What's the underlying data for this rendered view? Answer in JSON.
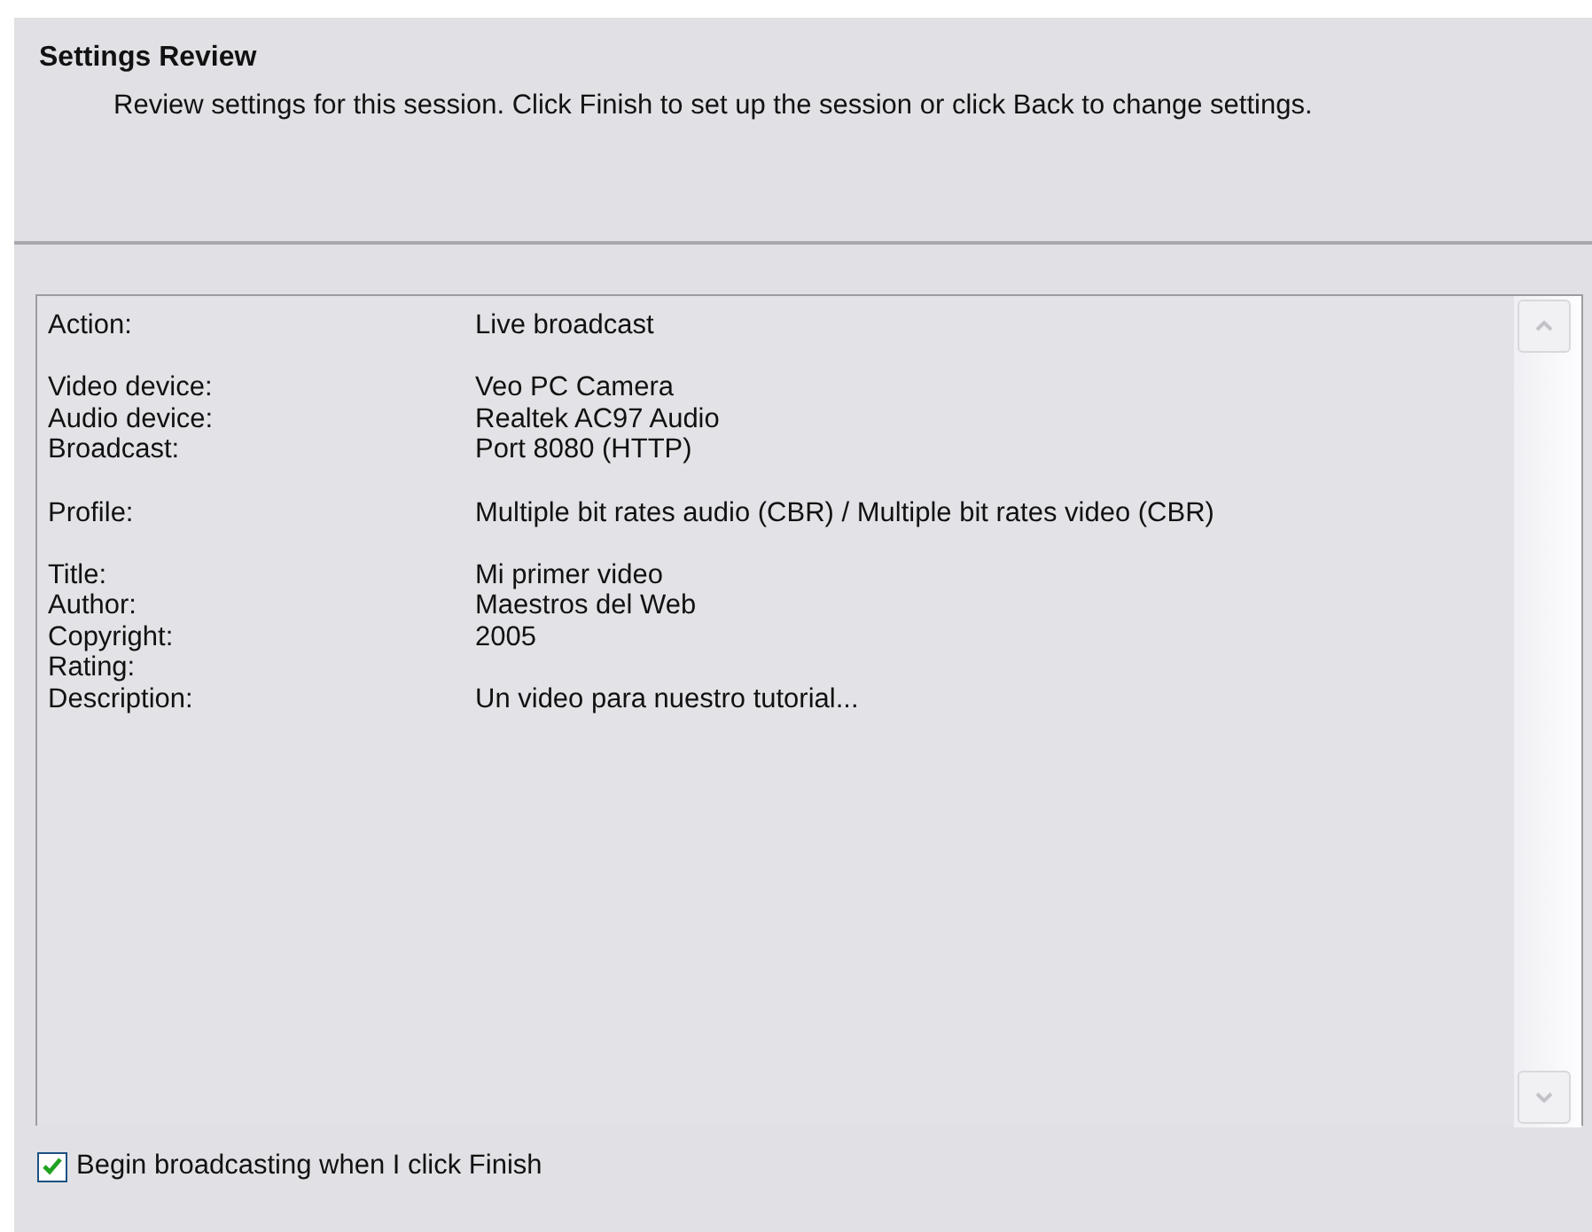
{
  "header": {
    "title": "Settings Review",
    "description": "Review settings for this session. Click Finish to set up the session or click Back to change settings."
  },
  "review": {
    "groups": [
      [
        {
          "label": "Action:",
          "value": "Live broadcast"
        }
      ],
      [
        {
          "label": "Video device:",
          "value": "Veo PC Camera"
        },
        {
          "label": "Audio device:",
          "value": "Realtek AC97 Audio"
        },
        {
          "label": "Broadcast:",
          "value": "Port 8080 (HTTP)"
        }
      ],
      [
        {
          "label": "Profile:",
          "value": "Multiple bit rates audio (CBR) / Multiple bit rates video (CBR)"
        }
      ],
      [
        {
          "label": "Title:",
          "value": "Mi primer video"
        },
        {
          "label": "Author:",
          "value": "Maestros del Web"
        },
        {
          "label": "Copyright:",
          "value": "2005"
        },
        {
          "label": "Rating:"
        },
        {
          "label": "Description:",
          "value": "Un video para nuestro tutorial..."
        }
      ]
    ]
  },
  "begin_option": {
    "label": "Begin broadcasting when I click Finish",
    "checked": true
  }
}
